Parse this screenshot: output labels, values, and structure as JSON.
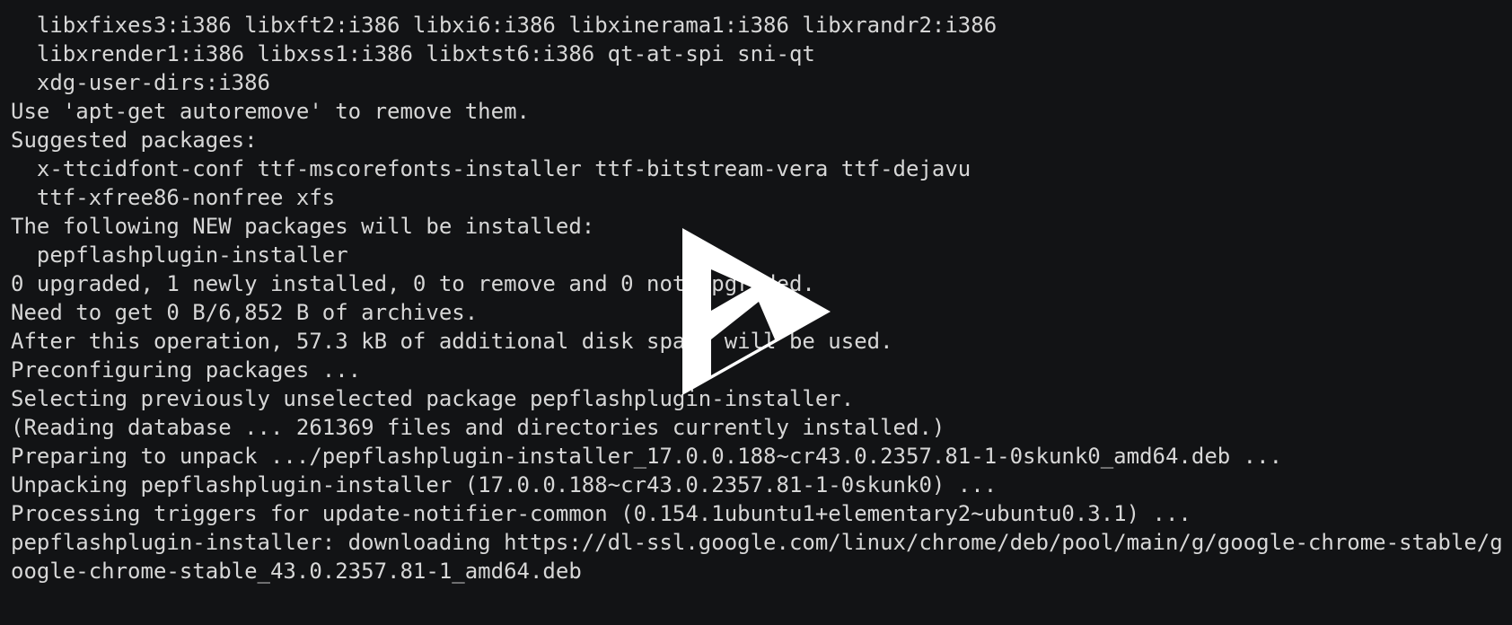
{
  "terminal": {
    "lines": [
      "  libxfixes3:i386 libxft2:i386 libxi6:i386 libxinerama1:i386 libxrandr2:i386",
      "  libxrender1:i386 libxss1:i386 libxtst6:i386 qt-at-spi sni-qt",
      "  xdg-user-dirs:i386",
      "Use 'apt-get autoremove' to remove them.",
      "Suggested packages:",
      "  x-ttcidfont-conf ttf-mscorefonts-installer ttf-bitstream-vera ttf-dejavu",
      "  ttf-xfree86-nonfree xfs",
      "The following NEW packages will be installed:",
      "  pepflashplugin-installer",
      "0 upgraded, 1 newly installed, 0 to remove and 0 not upgraded.",
      "Need to get 0 B/6,852 B of archives.",
      "After this operation, 57.3 kB of additional disk space will be used.",
      "Preconfiguring packages ...",
      "Selecting previously unselected package pepflashplugin-installer.",
      "(Reading database ... 261369 files and directories currently installed.)",
      "Preparing to unpack .../pepflashplugin-installer_17.0.0.188~cr43.0.2357.81-1-0skunk0_amd64.deb ...",
      "Unpacking pepflashplugin-installer (17.0.0.188~cr43.0.2357.81-1-0skunk0) ...",
      "Processing triggers for update-notifier-common (0.154.1ubuntu1+elementary2~ubuntu0.3.1) ...",
      "pepflashplugin-installer: downloading https://dl-ssl.google.com/linux/chrome/deb/pool/main/g/google-chrome-stable/g",
      "oogle-chrome-stable_43.0.2357.81-1_amd64.deb"
    ]
  },
  "overlay": {
    "icon": "asciinema-play-icon",
    "color": "#ffffff"
  },
  "colors": {
    "background": "#121315",
    "foreground": "#d7d7d7"
  }
}
